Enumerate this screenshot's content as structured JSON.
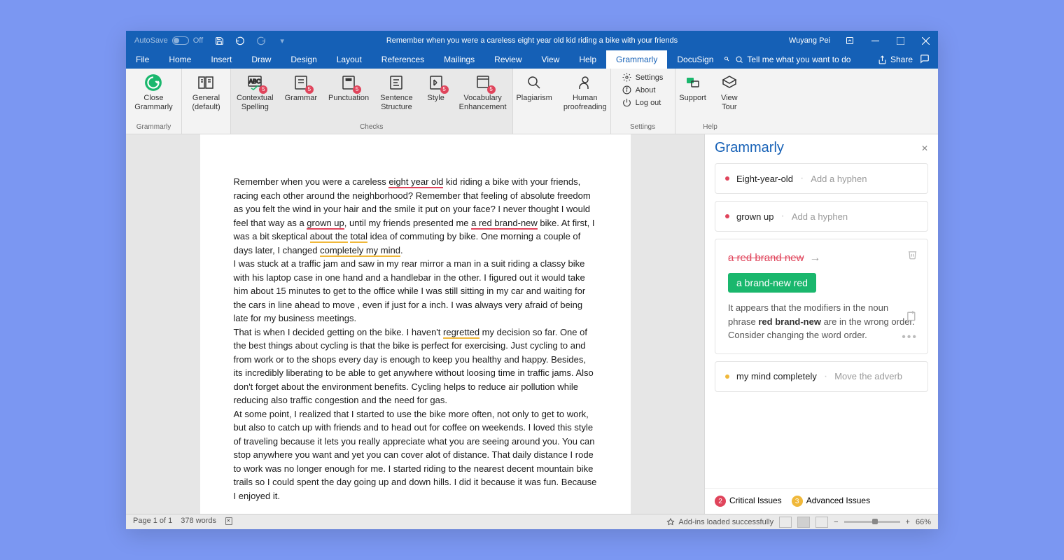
{
  "titlebar": {
    "autosave": "AutoSave",
    "autosave_state": "Off",
    "title": "Remember when you were a careless eight year old kid riding a bike with your friends",
    "user": "Wuyang Pei"
  },
  "menu": {
    "items": [
      "File",
      "Home",
      "Insert",
      "Draw",
      "Design",
      "Layout",
      "References",
      "Mailings",
      "Review",
      "View",
      "Help",
      "Grammarly",
      "DocuSign"
    ],
    "active_index": 11,
    "tellme": "Tell me what you want to do",
    "share": "Share"
  },
  "ribbon": {
    "grammarly_group": "Grammarly",
    "close_grammarly": "Close\nGrammarly",
    "general": "General\n(default)",
    "checks_label": "Checks",
    "checks": [
      {
        "label": "Contextual\nSpelling",
        "badge": "5"
      },
      {
        "label": "Grammar",
        "badge": "5"
      },
      {
        "label": "Punctuation",
        "badge": "5"
      },
      {
        "label": "Sentence\nStructure",
        "badge": ""
      },
      {
        "label": "Style",
        "badge": "5"
      },
      {
        "label": "Vocabulary\nEnhancement",
        "badge": "5"
      }
    ],
    "plagiarism": "Plagiarism",
    "human": "Human\nproofreading",
    "settings_label": "Settings",
    "settings_items": [
      "Settings",
      "About",
      "Log out"
    ],
    "help_label": "Help",
    "support": "Support",
    "viewtour": "View\nTour"
  },
  "document": {
    "p1_a": "Remember when you were a careless ",
    "p1_err1": "eight year old",
    "p1_b": " kid riding a bike with your friends, racing each other around the neighborhood? Remember that feeling of absolute freedom as you felt the wind in your hair and the smile it put on your face? I never thought I would feel that way as a ",
    "p1_err2": "grown up",
    "p1_c": ", until my friends presented me ",
    "p1_err3": "a red brand-new",
    "p1_d": " bike. At first, I was a bit skeptical ",
    "p1_y1": "about the",
    "p1_e": " ",
    "p1_y2": "total",
    "p1_f": " idea of commuting by bike. One morning a couple of days later, I changed ",
    "p1_y3": "completely my mind",
    "p1_g": ".",
    "p2": "I was stuck at a traffic jam and saw in my rear mirror a man in a suit riding a classy bike with his laptop case in one hand and a handlebar in the other. I figured out it would take him about 15 minutes to get to the office while I was still sitting in my car and waiting for the cars in line ahead to move , even if just for a inch. I was always very afraid of being late for my business meetings.",
    "p3_a": "That is when I decided getting on the bike. I haven't ",
    "p3_y1": "regretted",
    "p3_b": " my decision so far. One of the best things about cycling is that the bike is perfect for exercising. Just cycling to and from work or to the shops every day is enough to keep you healthy and happy. Besides, its incredibly liberating to be able to get anywhere without loosing time in traffic jams. Also don't forget about the environment benefits. Cycling helps to reduce air pollution while reducing also traffic congestion and the need for gas.",
    "p4": "At some point, I realized that I started to use the bike more often, not only to get to work, but also to catch up with friends and to head out for coffee on weekends. I loved this style of traveling because it lets you really appreciate what you are seeing around you. You can stop anywhere you want and yet you can cover alot of distance. That daily distance I rode to work was no longer enough for me. I started riding to the nearest decent mountain bike trails so I could spent the day going up and down hills. I did it because it was fun. Because I enjoyed it."
  },
  "panel": {
    "title": "Grammarly",
    "cards": [
      {
        "kind": "red",
        "term": "Eight-year-old",
        "hint": "Add a hyphen"
      },
      {
        "kind": "red",
        "term": "grown up",
        "hint": "Add a hyphen"
      }
    ],
    "expanded": {
      "strike": "a red brand new",
      "suggestion": "a brand-new red",
      "desc_a": "It appears that the modifiers in the noun phrase ",
      "desc_bold": "red brand-new",
      "desc_b": " are in the wrong order. Consider changing the word order."
    },
    "card_after": {
      "kind": "yellow",
      "term": "my mind completely",
      "hint": "Move the adverb"
    },
    "footer": {
      "critical_n": "2",
      "critical": "Critical Issues",
      "advanced_n": "3",
      "advanced": "Advanced Issues"
    }
  },
  "status": {
    "page": "Page 1 of 1",
    "words": "378 words",
    "addins": "Add-ins loaded successfully",
    "zoom": "66%"
  }
}
